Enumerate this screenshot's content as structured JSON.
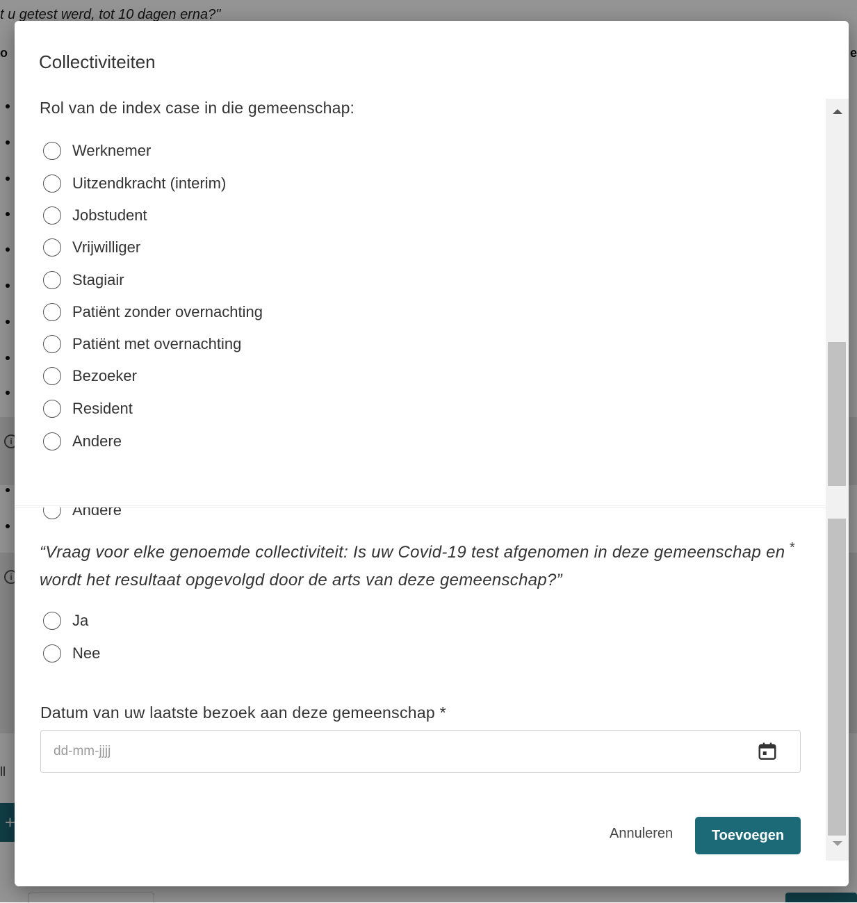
{
  "background": {
    "quote_fragment": "t u getest werd, tot 10 dagen erna?\"",
    "bold_left": "o",
    "bold_right": "e",
    "text_fragment": "ll",
    "plus": "+",
    "info": "i"
  },
  "modal": {
    "title": "Collectiviteiten",
    "role_question": "Rol van de index case in die gemeenschap:",
    "role_options": [
      "Werknemer",
      "Uitzendkracht (interim)",
      "Jobstudent",
      "Vrijwilliger",
      "Stagiair",
      "Patiënt zonder overnachting",
      "Patiënt met overnachting",
      "Bezoeker",
      "Resident",
      "Andere"
    ],
    "role_option_repeat": "Andere",
    "covid_question": "“Vraag voor elke genoemde collectiviteit: Is uw Covid-19 test afgenomen in deze gemeenschap en wordt het resultaat opgevolgd door de arts van deze gemeenschap?”",
    "required_marker": "*",
    "covid_options": [
      "Ja",
      "Nee"
    ],
    "date_label": "Datum van uw laatste bezoek aan deze gemeenschap *",
    "date_placeholder": "dd-mm-jjjj",
    "calendar_icon": "calendar-icon",
    "cancel_label": "Annuleren",
    "add_label": "Toevoegen"
  },
  "colors": {
    "accent": "#1c6a78",
    "scrollbar_thumb": "#c1c1c1"
  }
}
